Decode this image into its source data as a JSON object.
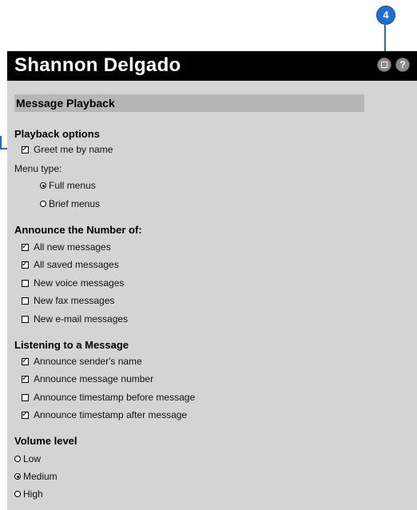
{
  "callout": {
    "number": "4"
  },
  "window": {
    "title": "Shannon Delgado"
  },
  "toolbar": {
    "print_icon": "print-icon",
    "help_icon": "help-icon",
    "help_glyph": "?"
  },
  "section": {
    "title": "Message Playback"
  },
  "playback": {
    "heading": "Playback options",
    "greet_label": "Greet me by name",
    "greet_checked": true,
    "menu_type_label": "Menu type:",
    "menu_options": [
      {
        "label": "Full menus",
        "selected": true
      },
      {
        "label": "Brief menus",
        "selected": false
      }
    ]
  },
  "announce": {
    "heading": "Announce the Number of:",
    "items": [
      {
        "label": "All new messages",
        "checked": true
      },
      {
        "label": "All saved messages",
        "checked": true
      },
      {
        "label": "New voice messages",
        "checked": false
      },
      {
        "label": "New fax messages",
        "checked": false
      },
      {
        "label": "New e-mail messages",
        "checked": false
      }
    ]
  },
  "listening": {
    "heading": "Listening to a Message",
    "items": [
      {
        "label": "Announce sender's name",
        "checked": true
      },
      {
        "label": "Announce message number",
        "checked": true
      },
      {
        "label": "Announce timestamp before message",
        "checked": false
      },
      {
        "label": "Announce timestamp after message",
        "checked": true
      }
    ]
  },
  "volume": {
    "heading": "Volume level",
    "options": [
      {
        "label": "Low",
        "selected": false
      },
      {
        "label": "Medium",
        "selected": true
      },
      {
        "label": "High",
        "selected": false
      }
    ]
  }
}
